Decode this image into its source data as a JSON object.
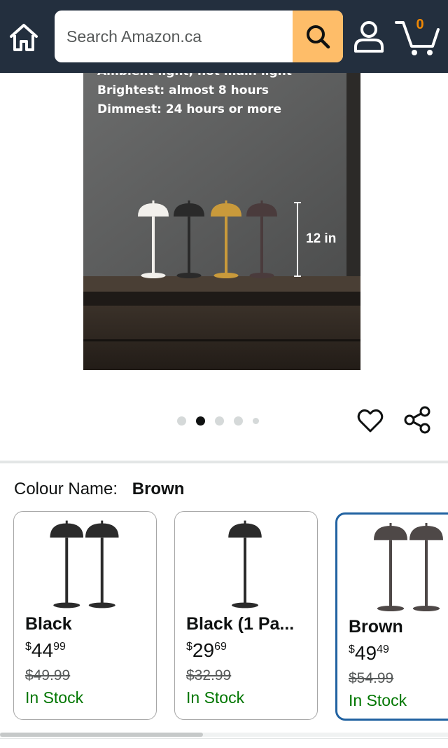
{
  "header": {
    "search_placeholder": "Search Amazon.ca",
    "cart_count": "0"
  },
  "product_image": {
    "caption_lines": [
      "Ambient light, not main light",
      "Brightest: almost 8 hours",
      "Dimmest: 24 hours or more"
    ],
    "height_label": "12 in",
    "lamp_colors": [
      "#f2f0ec",
      "#2a2a2a",
      "#c99a3b",
      "#4a3b3c"
    ]
  },
  "carousel": {
    "dot_count": 5,
    "active_index": 1
  },
  "colour": {
    "label": "Colour Name:",
    "selected_value": "Brown"
  },
  "swatches": [
    {
      "name": "Black",
      "price_symbol": "$",
      "price_whole": "44",
      "price_fraction": "99",
      "list_price": "$49.99",
      "availability": "In Stock",
      "lamp_color": "#2b2b2b",
      "lamp_count": 2,
      "selected": false
    },
    {
      "name": "Black (1 Pa...",
      "price_symbol": "$",
      "price_whole": "29",
      "price_fraction": "69",
      "list_price": "$32.99",
      "availability": "In Stock",
      "lamp_color": "#2b2b2b",
      "lamp_count": 1,
      "selected": false
    },
    {
      "name": "Brown",
      "price_symbol": "$",
      "price_whole": "49",
      "price_fraction": "49",
      "list_price": "$54.99",
      "availability": "In Stock",
      "lamp_color": "#4e4847",
      "lamp_count": 2,
      "selected": true
    }
  ],
  "colors": {
    "header_bg": "#232f3e",
    "search_button": "#febd69",
    "cart_count": "#f08804",
    "in_stock": "#007600",
    "selected_border": "#2162a1"
  },
  "icons": [
    "home-icon",
    "search-icon",
    "account-icon",
    "cart-icon",
    "heart-icon",
    "share-icon"
  ]
}
